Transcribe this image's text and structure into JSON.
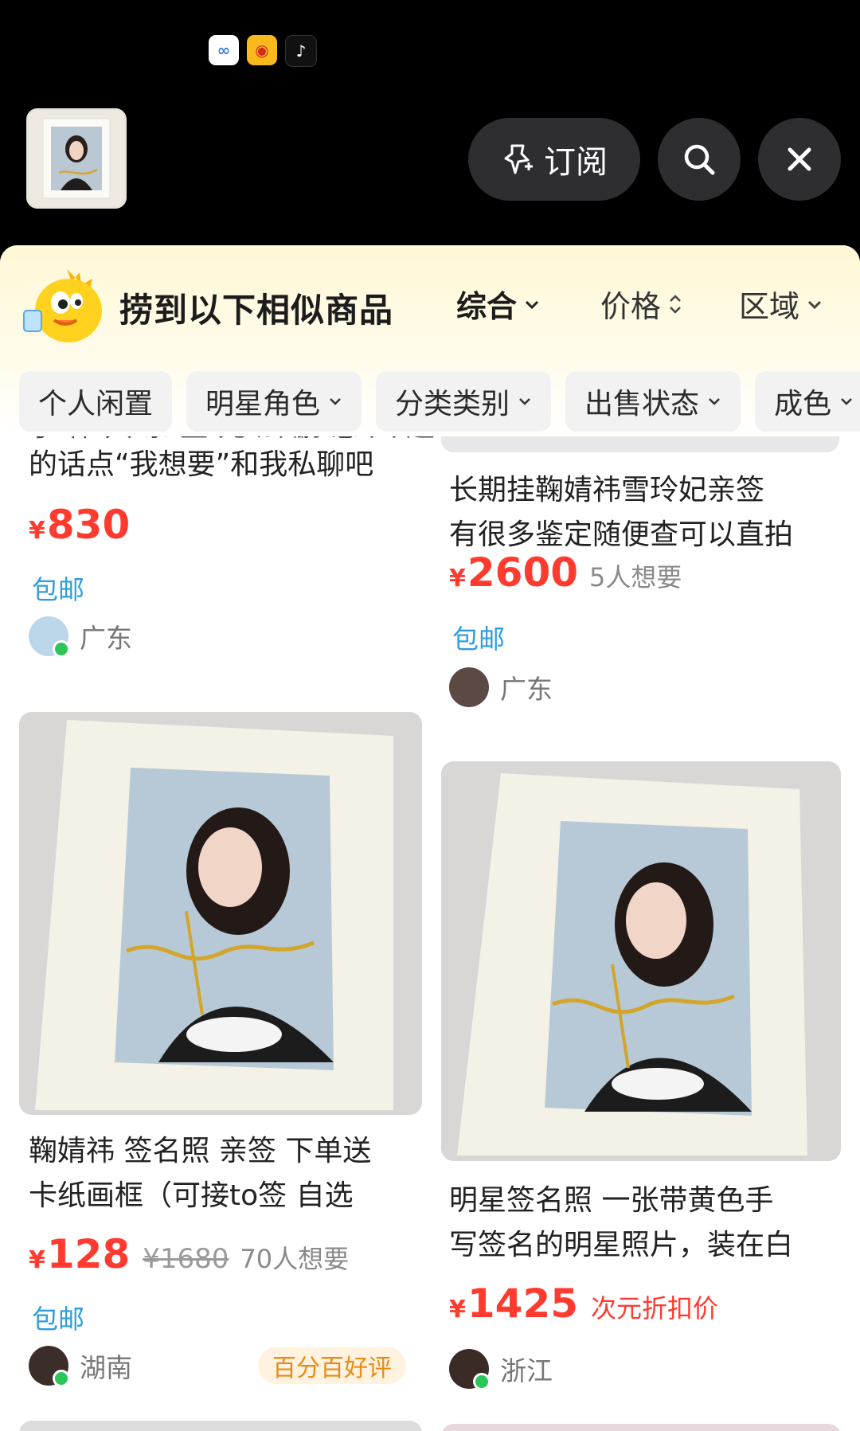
{
  "header": {
    "app_icons": [
      "baidu-cloud-icon",
      "weibo-icon",
      "tiktok-icon"
    ],
    "subscribe_label": "订阅",
    "search_icon": "search-icon",
    "close_icon": "close-icon"
  },
  "sheet": {
    "title": "捞到以下相似商品",
    "sort_options": [
      "综合",
      "价格",
      "区域"
    ],
    "filters": [
      "个人闲置",
      "明星角色",
      "分类类别",
      "出售状态",
      "成色"
    ]
  },
  "products": [
    {
      "title_lines": [
        "子 祎 只 亲 签 元 法 鹏 感 兴 趣",
        "的话点“我想要”和我私聊吧"
      ],
      "price": "830",
      "free_shipping": "包邮",
      "location": "广东"
    },
    {
      "title_lines": [
        "长期挂鞠婧祎雪玲妃亲签",
        "有很多鉴定随便查可以直拍"
      ],
      "price": "2600",
      "want": "5人想要",
      "free_shipping": "包邮",
      "location": "广东"
    },
    {
      "title_lines": [
        "鞠婧祎 签名照 亲签 下单送",
        "卡纸画框（可接to签 自选"
      ],
      "price": "128",
      "original_price": "¥1680",
      "want": "70人想要",
      "free_shipping": "包邮",
      "location": "湖南",
      "badge": "百分百好评"
    },
    {
      "title_lines": [
        "明星签名照 一张带黄色手",
        "写签名的明星照片，装在白"
      ],
      "price": "1425",
      "discount_label": "次元折扣价",
      "location": "浙江"
    }
  ],
  "currency": "¥",
  "colors": {
    "price": "#ff3b30",
    "shipping": "#2f9de0",
    "badge_text": "#e98a16"
  }
}
